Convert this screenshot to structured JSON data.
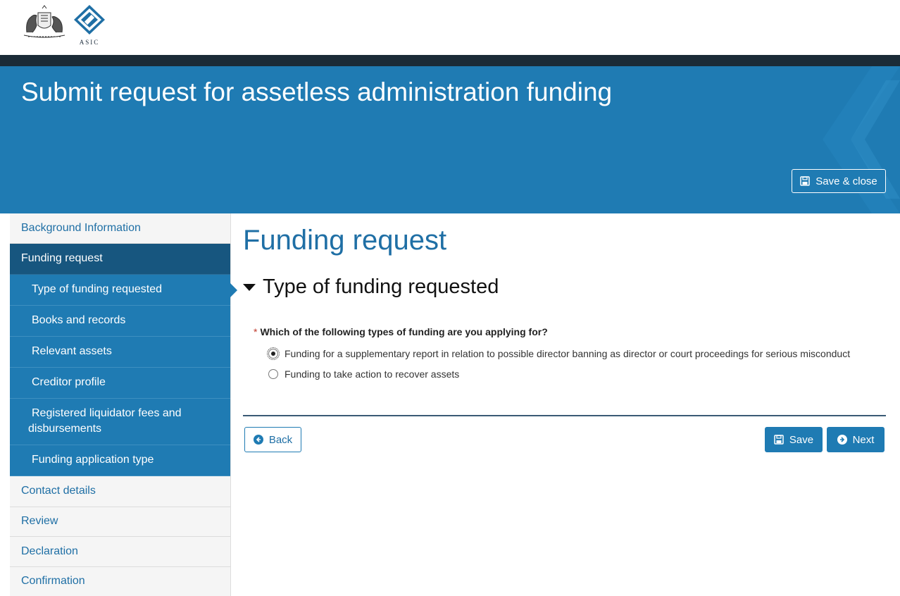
{
  "header": {
    "agency_text": "ASIC",
    "page_title": "Submit request for assetless administration funding",
    "save_close_label": "Save & close"
  },
  "sidebar": {
    "items": [
      {
        "label": "Background Information",
        "level": 0,
        "state": "default"
      },
      {
        "label": "Funding request",
        "level": 0,
        "state": "active"
      },
      {
        "label": "Type of funding requested",
        "level": 1,
        "state": "current"
      },
      {
        "label": "Books and records",
        "level": 1,
        "state": "default"
      },
      {
        "label": "Relevant assets",
        "level": 1,
        "state": "default"
      },
      {
        "label": "Creditor profile",
        "level": 1,
        "state": "default"
      },
      {
        "label": "Registered liquidator fees and disbursements",
        "level": 1,
        "state": "default"
      },
      {
        "label": "Funding application type",
        "level": 1,
        "state": "default"
      },
      {
        "label": "Contact details",
        "level": 0,
        "state": "default"
      },
      {
        "label": "Review",
        "level": 0,
        "state": "default"
      },
      {
        "label": "Declaration",
        "level": 0,
        "state": "default"
      },
      {
        "label": "Confirmation",
        "level": 0,
        "state": "default"
      }
    ]
  },
  "main": {
    "title": "Funding request",
    "section_title": "Type of funding requested",
    "question": {
      "required_marker": "*",
      "text": "Which of the following types of funding are you applying for?",
      "options": [
        {
          "label": "Funding for a supplementary report in relation to possible director banning as director or court proceedings for serious misconduct",
          "selected": true
        },
        {
          "label": "Funding to take action to recover assets",
          "selected": false
        }
      ]
    },
    "buttons": {
      "back": "Back",
      "save": "Save",
      "next": "Next"
    }
  },
  "colors": {
    "banner": "#1f7bb3",
    "dark_strip": "#1b2b37",
    "nav_active": "#17567f",
    "link": "#1f6fa5"
  }
}
